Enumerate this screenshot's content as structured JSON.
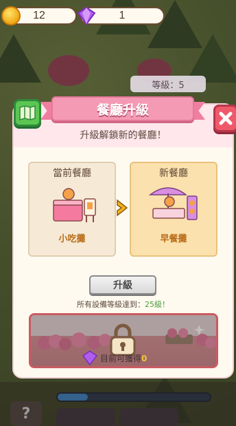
{
  "currency": {
    "coins": "12",
    "gems": "1",
    "coin_icon": "coin-icon",
    "gem_icon": "gem-icon"
  },
  "background": {
    "level_label": "等級：5"
  },
  "modal": {
    "title": "餐廳升級",
    "subtitle": "升級解鎖新的餐廳！",
    "current": {
      "header": "當前餐廳",
      "name": "小吃攤"
    },
    "next": {
      "header": "新餐廳",
      "name": "早餐攤"
    },
    "upgrade_label": "升級",
    "requirement_prefix": "所有設備等級達到：",
    "requirement_value": "25級！",
    "reward_prefix": "目前可獲得",
    "reward_value": "0"
  },
  "colors": {
    "ribbon": "#f59ab4",
    "close": "#ef5a6a",
    "map": "#5cc653",
    "accent_green": "#4a9b3a",
    "restaurant_name": "#b96d1a"
  }
}
